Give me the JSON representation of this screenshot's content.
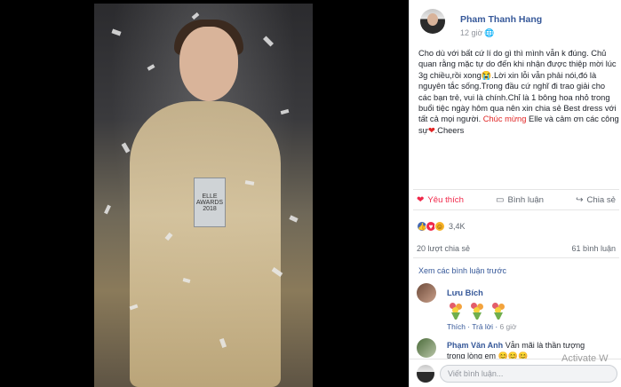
{
  "viewer": {
    "trophy_lines": [
      "ELLE",
      "AWARDS",
      "2018"
    ]
  },
  "post": {
    "author": "Pham Thanh Hang",
    "time": "12 giờ",
    "text_before": "Cho dù với bất cứ lí do gì thì mình vẫn k đúng. Chủ quan rằng mặc tự do đến khi nhận được thiệp mời lúc 3g chiều,rồi xong😭.Lời xin lỗi vẫn phải nói,đó là nguyên tắc sống.Trong đầu cứ nghĩ đi trao giải cho các bạn trẻ, vui là chính.Chỉ là 1 bông hoa nhỏ trong buổi tiệc ngày hôm qua nên xin chia sẻ Best dress với tất cả mọi người.",
    "text_highlight": "Chúc mừng",
    "text_after": " Elle và cảm ơn các công sự",
    "text_end": ".Cheers"
  },
  "actions": {
    "like": "Yêu thích",
    "comment": "Bình luận",
    "share": "Chia sẻ"
  },
  "reactions": {
    "count": "3,4K"
  },
  "stats": {
    "shares": "20 lượt chia sẻ",
    "comments": "61 bình luận"
  },
  "comments": {
    "previous": "Xem các bình luận trước",
    "items": [
      {
        "name": "Lưu Bích",
        "like": "Thích",
        "reply": "Trả lời",
        "time": "6 giờ"
      },
      {
        "name": "Phạm Văn Anh",
        "text": "Vẫn mãi là thần tượng",
        "text2": "trong lòng em 😊😊😊"
      }
    ]
  },
  "composer": {
    "placeholder": "Viết bình luận..."
  },
  "overlay": {
    "activate": "Activate W"
  },
  "colors": {
    "link": "#365899",
    "liked": "#f0284a",
    "highlight": "#e02424"
  }
}
